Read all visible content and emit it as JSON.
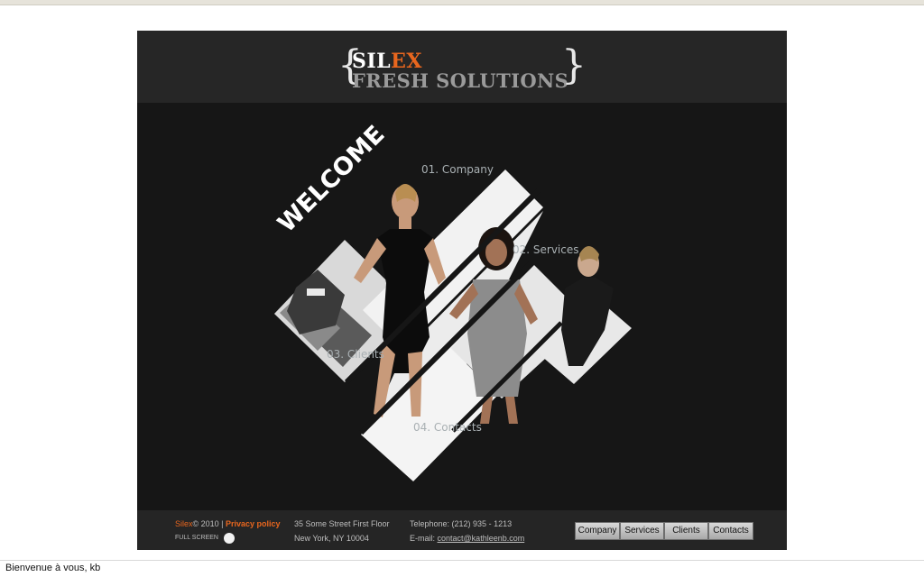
{
  "header": {
    "brace_left": "{",
    "brace_right": "}",
    "logo_part1": "SIL",
    "logo_part2": "EX",
    "logo_line2": "FRESH SOLUTIONS"
  },
  "stage": {
    "welcome": "WELCOME",
    "menu": {
      "company": "01. Company",
      "services": "02. Services",
      "clients": "03. Clients",
      "contacts": "04. Contacts"
    }
  },
  "footer": {
    "brand": "Silex",
    "copyright": "© 2010 |",
    "privacy": "Privacy policy",
    "fullscreen": "FULL SCREEN",
    "address1": "35 Some Street First Floor",
    "address2": "New York, NY 10004",
    "telephone": "Telephone: (212) 935 - 1213",
    "email_label": "E-mail:",
    "email": "contact@kathleenb.com",
    "nav": [
      "Company",
      "Services",
      "Clients",
      "Contacts"
    ]
  },
  "statusbar": {
    "text": "Bienvenue à vous, kb"
  },
  "colors": {
    "accent": "#e8661e",
    "background": "#161616",
    "header": "#262626"
  }
}
